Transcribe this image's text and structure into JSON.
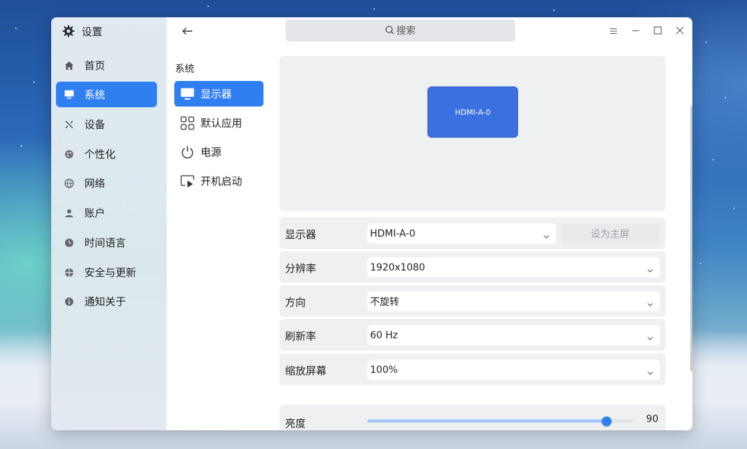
{
  "app": {
    "title": "设置"
  },
  "nav": {
    "items": [
      {
        "label": "首页",
        "icon": "home-icon"
      },
      {
        "label": "系统",
        "icon": "monitor-icon",
        "active": true
      },
      {
        "label": "设备",
        "icon": "tools-icon"
      },
      {
        "label": "个性化",
        "icon": "palette-icon"
      },
      {
        "label": "网络",
        "icon": "globe-icon"
      },
      {
        "label": "账户",
        "icon": "user-icon"
      },
      {
        "label": "时间语言",
        "icon": "clock-icon"
      },
      {
        "label": "安全与更新",
        "icon": "shield-icon"
      },
      {
        "label": "通知关于",
        "icon": "info-icon"
      }
    ]
  },
  "subnav": {
    "section_title": "系统",
    "items": [
      {
        "label": "显示器",
        "icon": "display-icon",
        "active": true
      },
      {
        "label": "默认应用",
        "icon": "grid-icon"
      },
      {
        "label": "电源",
        "icon": "power-icon"
      },
      {
        "label": "开机启动",
        "icon": "startup-icon"
      }
    ]
  },
  "search": {
    "placeholder": "搜索"
  },
  "preview": {
    "monitor_label": "HDMI-A-0"
  },
  "settings": {
    "monitor": {
      "label": "显示器",
      "value": "HDMI-A-0",
      "primary_button": "设为主屏"
    },
    "resolution": {
      "label": "分辨率",
      "value": "1920x1080"
    },
    "orientation": {
      "label": "方向",
      "value": "不旋转"
    },
    "refresh": {
      "label": "刷新率",
      "value": "60 Hz"
    },
    "scale": {
      "label": "缩放屏幕",
      "value": "100%"
    },
    "brightness": {
      "label": "亮度",
      "value": "90",
      "fraction": 0.9
    }
  },
  "colors": {
    "accent": "#2f7ff1",
    "monitor_tile": "#3b70e0"
  }
}
